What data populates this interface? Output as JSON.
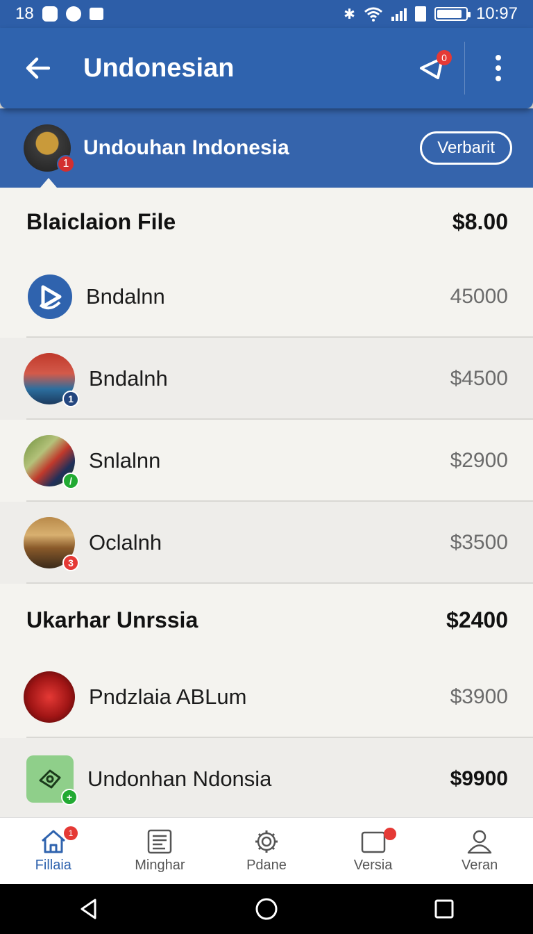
{
  "status_bar": {
    "left_number": "18",
    "time": "10:97"
  },
  "app_bar": {
    "title": "Undonesian",
    "share_badge": "0"
  },
  "channel": {
    "name": "Undouhan Indonesia",
    "avatar_badge": "1",
    "follow_label": "Verbarit"
  },
  "sections": [
    {
      "title": "Blaiclaion File",
      "total": "$8.00",
      "items": [
        {
          "name": "Bndalnn",
          "price": "45000",
          "badge": "",
          "thumb": "play-logo",
          "price_dark": false
        },
        {
          "name": "Bndalnh",
          "price": "$4500",
          "badge": "1",
          "thumb": "city-photo",
          "price_dark": false
        },
        {
          "name": "Snlalnn",
          "price": "$2900",
          "badge": "/",
          "thumb": "flag-photo",
          "price_dark": false
        },
        {
          "name": "Oclalnh",
          "price": "$3500",
          "badge": "3",
          "thumb": "street-photo",
          "price_dark": false
        }
      ]
    },
    {
      "title": "Ukarhar Unrssia",
      "total": "$2400",
      "items": [
        {
          "name": "Pndzlaia ABLum",
          "price": "$3900",
          "badge": "",
          "thumb": "album-cover",
          "price_dark": false
        },
        {
          "name": "Undonhan Ndonsia",
          "price": "$9900",
          "badge": "+",
          "thumb": "money-icon",
          "price_dark": true
        }
      ]
    }
  ],
  "bottom_nav": [
    {
      "label": "Fillaia",
      "icon": "home-icon",
      "badge": "1",
      "active": true
    },
    {
      "label": "Minghar",
      "icon": "list-icon",
      "badge": "",
      "active": false
    },
    {
      "label": "Pdane",
      "icon": "gear-icon",
      "badge": "",
      "active": false
    },
    {
      "label": "Versia",
      "icon": "inbox-icon",
      "badge": "",
      "active": false
    },
    {
      "label": "Veran",
      "icon": "person-icon",
      "badge": "",
      "active": false
    }
  ],
  "colors": {
    "primary": "#2f63ae",
    "badge_red": "#e53935",
    "badge_green": "#22aa33",
    "background": "#f4f3ef"
  }
}
